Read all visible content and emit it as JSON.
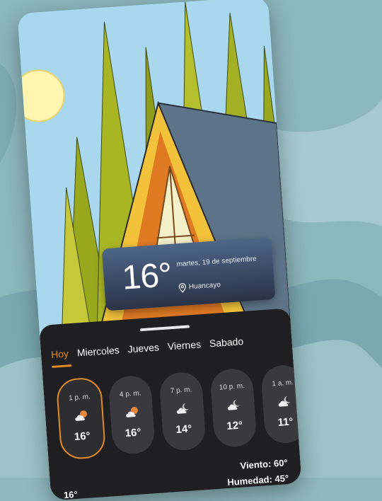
{
  "current": {
    "temperature": "16°",
    "date": "martes, 19 de septiembre",
    "city": "Huancayo"
  },
  "tabs": [
    {
      "label": "Hoy",
      "active": true
    },
    {
      "label": "Miercoles",
      "active": false
    },
    {
      "label": "Jueves",
      "active": false
    },
    {
      "label": "Viernes",
      "active": false
    },
    {
      "label": "Sabado",
      "active": false
    }
  ],
  "hourly": [
    {
      "time": "1 p. m.",
      "icon": "partly-cloudy-sun-icon",
      "temp": "16°"
    },
    {
      "time": "4 p. m.",
      "icon": "partly-cloudy-sun-icon",
      "temp": "16°"
    },
    {
      "time": "7 p. m.",
      "icon": "partly-cloudy-night-icon",
      "temp": "14°"
    },
    {
      "time": "10 p. m.",
      "icon": "partly-cloudy-night-icon",
      "temp": "12°"
    },
    {
      "time": "1 a. m.",
      "icon": "partly-cloudy-night-icon",
      "temp": "11°"
    }
  ],
  "details": {
    "wind_label": "Viento:",
    "wind_value": "60°",
    "humidity_label": "Humedad:",
    "humidity_value": "45°",
    "feels_partial": "16°"
  },
  "colors": {
    "accent": "#e08a2b",
    "panel": "#1f1f21",
    "card_top": "#4d6688",
    "card_bottom": "#2a3347"
  }
}
